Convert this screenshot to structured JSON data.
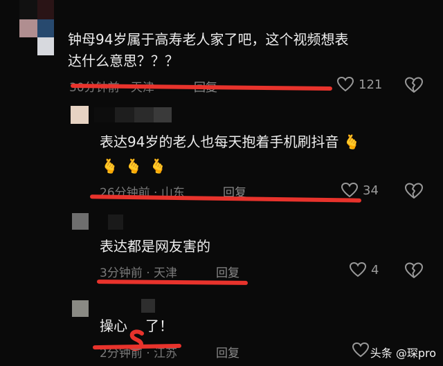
{
  "comments": [
    {
      "text_line1": "钟母94岁属于高寿老人家了吧，这个视频想表",
      "text_line2": "达什么意思？？？",
      "time": "30分钟前",
      "location": "天津",
      "reply_label": "回复",
      "likes": "121"
    },
    {
      "text_line1": "表达94岁的老人也每天抱着手机刷抖音",
      "time": "26分钟前",
      "location": "山东",
      "reply_label": "回复",
      "likes": "34",
      "emoji_names": [
        "crossed-fingers-heart-emoji",
        "crossed-fingers-heart-emoji",
        "crossed-fingers-heart-emoji",
        "crossed-fingers-heart-emoji"
      ]
    },
    {
      "text_line1": "表达都是网友害的",
      "time": "3分钟前",
      "location": "天津",
      "reply_label": "回复",
      "likes": "4"
    },
    {
      "text_line1": "操心",
      "text_line1_end": "了！",
      "time": "2分钟前",
      "location": "江苏",
      "reply_label": "回复"
    }
  ],
  "watermark": {
    "text": "头条 @琛pro"
  },
  "colors": {
    "background": "#0a0a0a",
    "highlight_underline": "#e8332c",
    "text": "#ededed",
    "meta": "#7a7a7a"
  }
}
